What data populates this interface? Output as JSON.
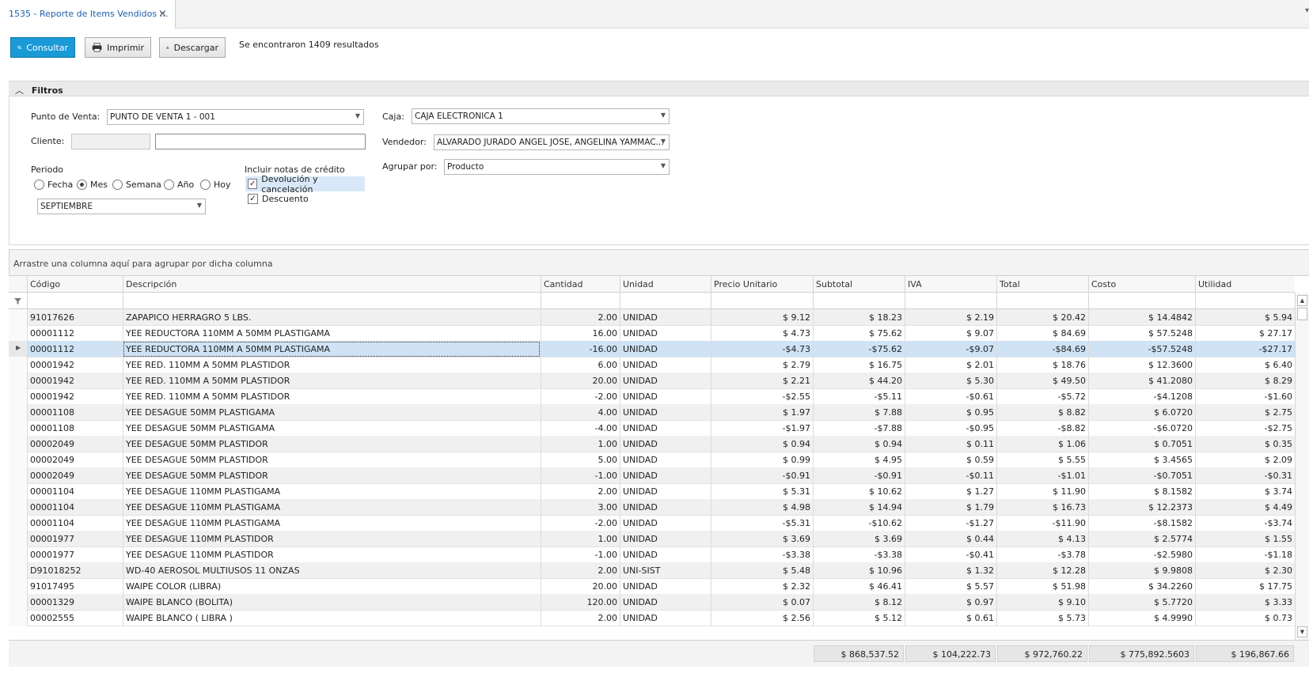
{
  "tab": {
    "title": "1535 - Reporte de Items Vendidos ::.",
    "close": "×"
  },
  "toolbar": {
    "consultar": "Consultar",
    "imprimir": "Imprimir",
    "descargar": "Descargar",
    "result_count": "Se encontraron 1409 resultados"
  },
  "filters": {
    "header": "Filtros",
    "punto_venta_label": "Punto de Venta:",
    "punto_venta_value": "PUNTO DE VENTA 1 - 001",
    "caja_label": "Caja:",
    "caja_value": "CAJA ELECTRONICA 1",
    "cliente_label": "Cliente:",
    "vendedor_label": "Vendedor:",
    "vendedor_value": "ALVARADO JURADO ANGEL JOSE, ANGELINA YAMMAC...",
    "periodo_label": "Periodo",
    "periodo_options": [
      "Fecha",
      "Mes",
      "Semana",
      "Año",
      "Hoy"
    ],
    "periodo_selected": "Mes",
    "mes_value": "SEPTIEMBRE",
    "notas_label": "Incluir notas de crédito",
    "notas_options": [
      {
        "label": "Devolución y cancelación",
        "checked": true
      },
      {
        "label": "Descuento",
        "checked": true
      }
    ],
    "agrupar_label": "Agrupar por:",
    "agrupar_value": "Producto"
  },
  "grid": {
    "group_panel_text": "Arrastre una columna aquí para agrupar por dicha columna",
    "columns": [
      "Código",
      "Descripción",
      "Cantidad",
      "Unidad",
      "Precio Unitario",
      "Subtotal",
      "IVA",
      "Total",
      "Costo",
      "Utilidad"
    ],
    "rows": [
      [
        "91017626",
        "ZAPAPICO HERRAGRO 5 LBS.",
        "2.00",
        "UNIDAD",
        "$ 9.12",
        "$ 18.23",
        "$ 2.19",
        "$ 20.42",
        "$ 14.4842",
        "$ 5.94"
      ],
      [
        "00001112",
        "YEE REDUCTORA 110MM A 50MM PLASTIGAMA",
        "16.00",
        "UNIDAD",
        "$ 4.73",
        "$ 75.62",
        "$ 9.07",
        "$ 84.69",
        "$ 57.5248",
        "$ 27.17"
      ],
      [
        "00001112",
        "YEE REDUCTORA 110MM A 50MM PLASTIGAMA",
        "-16.00",
        "UNIDAD",
        "-$4.73",
        "-$75.62",
        "-$9.07",
        "-$84.69",
        "-$57.5248",
        "-$27.17"
      ],
      [
        "00001942",
        "YEE RED. 110MM A 50MM PLASTIDOR",
        "6.00",
        "UNIDAD",
        "$ 2.79",
        "$ 16.75",
        "$ 2.01",
        "$ 18.76",
        "$ 12.3600",
        "$ 6.40"
      ],
      [
        "00001942",
        "YEE RED. 110MM A 50MM PLASTIDOR",
        "20.00",
        "UNIDAD",
        "$ 2.21",
        "$ 44.20",
        "$ 5.30",
        "$ 49.50",
        "$ 41.2080",
        "$ 8.29"
      ],
      [
        "00001942",
        "YEE RED. 110MM A 50MM PLASTIDOR",
        "-2.00",
        "UNIDAD",
        "-$2.55",
        "-$5.11",
        "-$0.61",
        "-$5.72",
        "-$4.1208",
        "-$1.60"
      ],
      [
        "00001108",
        "YEE DESAGUE 50MM PLASTIGAMA",
        "4.00",
        "UNIDAD",
        "$ 1.97",
        "$ 7.88",
        "$ 0.95",
        "$ 8.82",
        "$ 6.0720",
        "$ 2.75"
      ],
      [
        "00001108",
        "YEE DESAGUE 50MM PLASTIGAMA",
        "-4.00",
        "UNIDAD",
        "-$1.97",
        "-$7.88",
        "-$0.95",
        "-$8.82",
        "-$6.0720",
        "-$2.75"
      ],
      [
        "00002049",
        "YEE DESAGUE 50MM PLASTIDOR",
        "1.00",
        "UNIDAD",
        "$ 0.94",
        "$ 0.94",
        "$ 0.11",
        "$ 1.06",
        "$ 0.7051",
        "$ 0.35"
      ],
      [
        "00002049",
        "YEE DESAGUE 50MM PLASTIDOR",
        "5.00",
        "UNIDAD",
        "$ 0.99",
        "$ 4.95",
        "$ 0.59",
        "$ 5.55",
        "$ 3.4565",
        "$ 2.09"
      ],
      [
        "00002049",
        "YEE DESAGUE 50MM PLASTIDOR",
        "-1.00",
        "UNIDAD",
        "-$0.91",
        "-$0.91",
        "-$0.11",
        "-$1.01",
        "-$0.7051",
        "-$0.31"
      ],
      [
        "00001104",
        "YEE DESAGUE 110MM PLASTIGAMA",
        "2.00",
        "UNIDAD",
        "$ 5.31",
        "$ 10.62",
        "$ 1.27",
        "$ 11.90",
        "$ 8.1582",
        "$ 3.74"
      ],
      [
        "00001104",
        "YEE DESAGUE 110MM PLASTIGAMA",
        "3.00",
        "UNIDAD",
        "$ 4.98",
        "$ 14.94",
        "$ 1.79",
        "$ 16.73",
        "$ 12.2373",
        "$ 4.49"
      ],
      [
        "00001104",
        "YEE DESAGUE 110MM PLASTIGAMA",
        "-2.00",
        "UNIDAD",
        "-$5.31",
        "-$10.62",
        "-$1.27",
        "-$11.90",
        "-$8.1582",
        "-$3.74"
      ],
      [
        "00001977",
        "YEE DESAGUE 110MM PLASTIDOR",
        "1.00",
        "UNIDAD",
        "$ 3.69",
        "$ 3.69",
        "$ 0.44",
        "$ 4.13",
        "$ 2.5774",
        "$ 1.55"
      ],
      [
        "00001977",
        "YEE DESAGUE 110MM PLASTIDOR",
        "-1.00",
        "UNIDAD",
        "-$3.38",
        "-$3.38",
        "-$0.41",
        "-$3.78",
        "-$2.5980",
        "-$1.18"
      ],
      [
        "D91018252",
        "WD-40 AEROSOL MULTIUSOS 11 ONZAS",
        "2.00",
        "UNI-SIST",
        "$ 5.48",
        "$ 10.96",
        "$ 1.32",
        "$ 12.28",
        "$ 9.9808",
        "$ 2.30"
      ],
      [
        "91017495",
        "WAIPE COLOR (LIBRA)",
        "20.00",
        "UNIDAD",
        "$ 2.32",
        "$ 46.41",
        "$ 5.57",
        "$ 51.98",
        "$ 34.2260",
        "$ 17.75"
      ],
      [
        "00001329",
        "WAIPE BLANCO (BOLITA)",
        "120.00",
        "UNIDAD",
        "$ 0.07",
        "$ 8.12",
        "$ 0.97",
        "$ 9.10",
        "$ 5.7720",
        "$ 3.33"
      ],
      [
        "00002555",
        "WAIPE BLANCO ( LIBRA )",
        "2.00",
        "UNIDAD",
        "$ 2.56",
        "$ 5.12",
        "$ 0.61",
        "$ 5.73",
        "$ 4.9990",
        "$ 0.73"
      ]
    ],
    "selected_row": 2,
    "totals": {
      "subtotal": "$ 868,537.52",
      "iva": "$ 104,222.73",
      "total": "$ 972,760.22",
      "costo": "$ 775,892.5603",
      "utilidad": "$ 196,867.66"
    }
  },
  "colors": {
    "accent": "#1a9ad6",
    "selected_row": "#cfe3f5",
    "alt_row": "#f0f0f0"
  }
}
